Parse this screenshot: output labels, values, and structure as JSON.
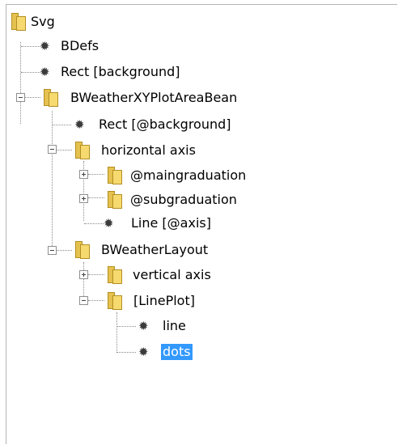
{
  "tree": {
    "root": {
      "label": "Svg"
    },
    "bdefs": {
      "label": "BDefs"
    },
    "rect_background": {
      "label": "Rect [background]"
    },
    "plot_area_bean": {
      "label": "BWeatherXYPlotAreaBean"
    },
    "rect_at_background": {
      "label": "Rect [@background]"
    },
    "horizontal_axis": {
      "label": "horizontal axis"
    },
    "maingraduation": {
      "label": "@maingraduation"
    },
    "subgraduation": {
      "label": "@subgraduation"
    },
    "line_axis": {
      "label": "Line [@axis]"
    },
    "weather_layout": {
      "label": "BWeatherLayout"
    },
    "vertical_axis": {
      "label": "vertical axis"
    },
    "lineplot": {
      "label": "[LinePlot]"
    },
    "line": {
      "label": "line"
    },
    "dots": {
      "label": "dots"
    }
  },
  "selected_node": "dots",
  "colors": {
    "selection": "#3399ff",
    "folder": "#f6da70"
  }
}
